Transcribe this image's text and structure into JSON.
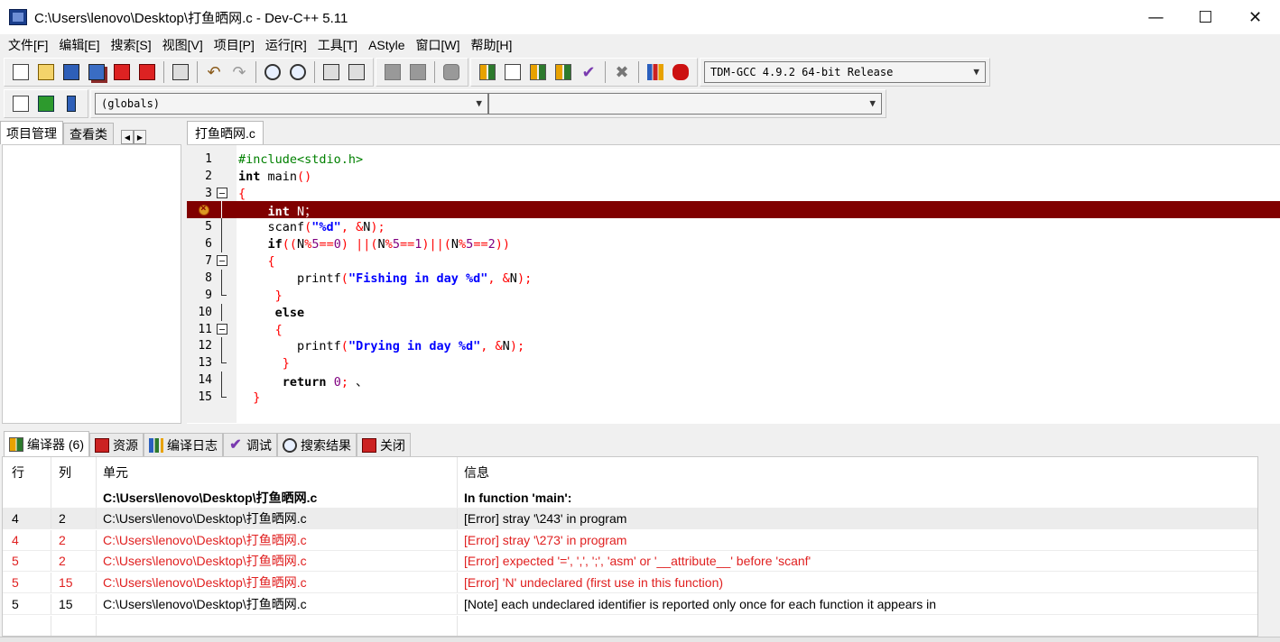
{
  "window": {
    "title": "C:\\Users\\lenovo\\Desktop\\打鱼晒网.c - Dev-C++ 5.11",
    "minimize": "—",
    "maximize": "☐",
    "close": "✕"
  },
  "menu": [
    "文件[F]",
    "编辑[E]",
    "搜索[S]",
    "视图[V]",
    "项目[P]",
    "运行[R]",
    "工具[T]",
    "AStyle",
    "窗口[W]",
    "帮助[H]"
  ],
  "toolbar": {
    "compiler_select": "TDM-GCC 4.9.2 64-bit Release",
    "scope_select": "(globals)",
    "function_select": ""
  },
  "left_panel": {
    "tabs": [
      "项目管理",
      "查看类"
    ]
  },
  "editor": {
    "tab": "打鱼晒网.c",
    "line_numbers": [
      "1",
      "2",
      "3",
      "4",
      "5",
      "6",
      "7",
      "8",
      "9",
      "10",
      "11",
      "12",
      "13",
      "14",
      "15"
    ]
  },
  "bottom_tabs": [
    "编译器 (6)",
    "资源",
    "编译日志",
    "调试",
    "搜索结果",
    "关闭"
  ],
  "messages": {
    "headers": {
      "line": "行",
      "col": "列",
      "unit": "单元",
      "message": "信息"
    },
    "rows": [
      {
        "line": "",
        "col": "",
        "unit": "C:\\Users\\lenovo\\Desktop\\打鱼晒网.c",
        "message": "In function 'main':"
      },
      {
        "line": "4",
        "col": "2",
        "unit": "C:\\Users\\lenovo\\Desktop\\打鱼晒网.c",
        "message": "[Error] stray '\\243' in program"
      },
      {
        "line": "4",
        "col": "2",
        "unit": "C:\\Users\\lenovo\\Desktop\\打鱼晒网.c",
        "message": "[Error] stray '\\273' in program"
      },
      {
        "line": "5",
        "col": "2",
        "unit": "C:\\Users\\lenovo\\Desktop\\打鱼晒网.c",
        "message": "[Error] expected '=', ',', ';', 'asm' or '__attribute__' before 'scanf'"
      },
      {
        "line": "5",
        "col": "15",
        "unit": "C:\\Users\\lenovo\\Desktop\\打鱼晒网.c",
        "message": "[Error] 'N' undeclared (first use in this function)"
      },
      {
        "line": "5",
        "col": "15",
        "unit": "C:\\Users\\lenovo\\Desktop\\打鱼晒网.c",
        "message": "[Note] each undeclared identifier is reported only once for each function it appears in"
      }
    ]
  },
  "colors": {
    "error_line": "#800000",
    "error_text": "#e02020",
    "string": "#0000ff",
    "preprocessor": "#008000",
    "symbol": "#ff0000"
  }
}
